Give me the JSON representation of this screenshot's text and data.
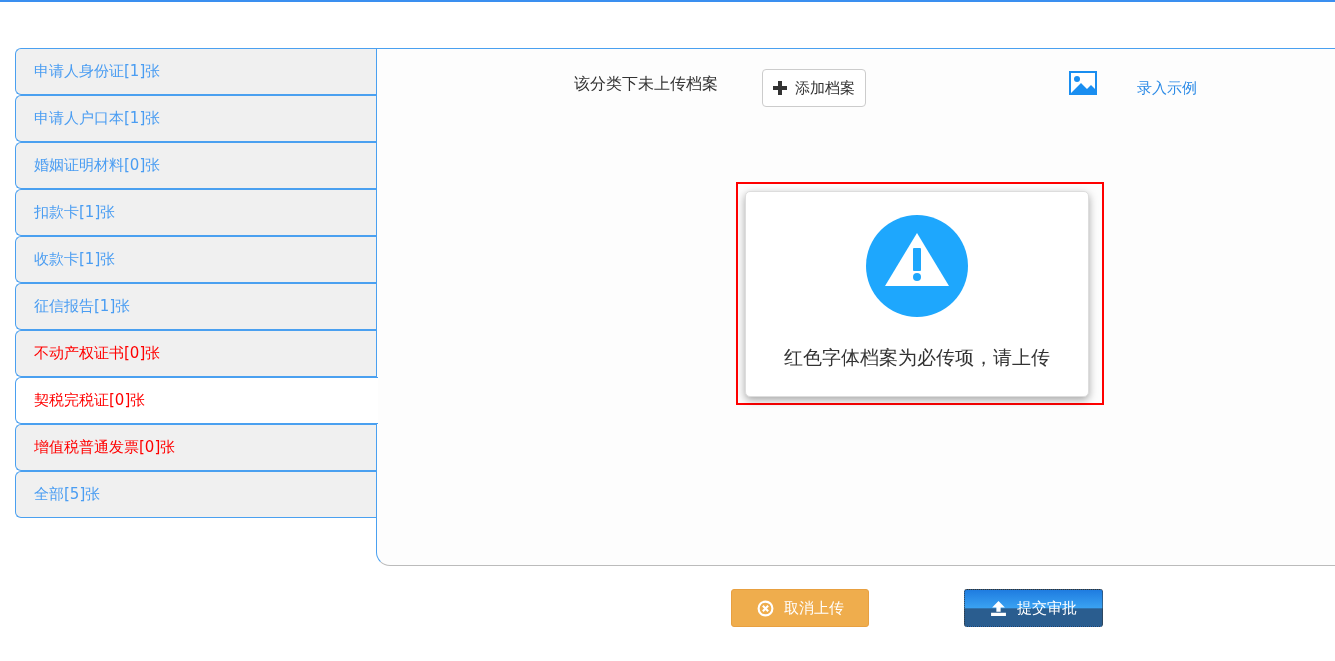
{
  "tabs": [
    {
      "label": "申请人身份证[1]张",
      "required": false,
      "selected": false
    },
    {
      "label": "申请人户口本[1]张",
      "required": false,
      "selected": false
    },
    {
      "label": "婚姻证明材料[0]张",
      "required": false,
      "selected": false
    },
    {
      "label": "扣款卡[1]张",
      "required": false,
      "selected": false
    },
    {
      "label": "收款卡[1]张",
      "required": false,
      "selected": false
    },
    {
      "label": "征信报告[1]张",
      "required": false,
      "selected": false
    },
    {
      "label": "不动产权证书[0]张",
      "required": true,
      "selected": false
    },
    {
      "label": "契税完税证[0]张",
      "required": true,
      "selected": true
    },
    {
      "label": "增值税普通发票[0]张",
      "required": true,
      "selected": false
    },
    {
      "label": "全部[5]张",
      "required": false,
      "selected": false
    }
  ],
  "panel": {
    "empty_message": "该分类下未上传档案",
    "add_button": "添加档案",
    "example_link": "录入示例"
  },
  "alert": {
    "message": "红色字体档案为必传项，请上传"
  },
  "buttons": {
    "cancel": "取消上传",
    "submit": "提交审批"
  }
}
